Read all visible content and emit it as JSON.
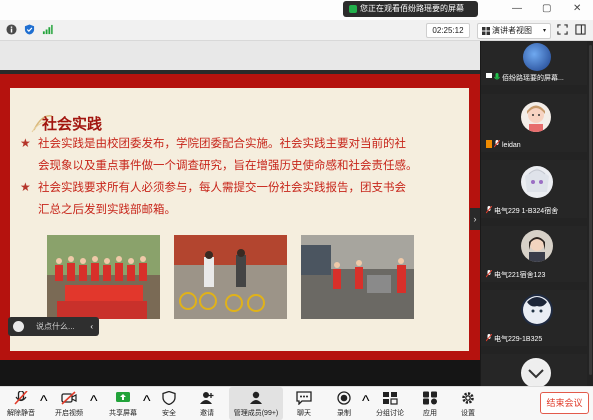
{
  "share_banner": {
    "text": "您正在观看佰纷路瑶要的屏幕"
  },
  "window_controls": {
    "minimize": "—",
    "maximize": "▢",
    "close": "✕"
  },
  "timer": "02:25:12",
  "view_button": {
    "label": "演讲者视图",
    "caret": "▾"
  },
  "slide": {
    "title": "社会实践",
    "bullets": [
      {
        "lines": [
          "社会实践是由校团委发布，学院团委配合实施。社会实践主要对当前的社",
          "会现象以及重点事件做一个调查研究，旨在增强历史使命感和社会责任感。"
        ]
      },
      {
        "lines": [
          "社会实践要求所有人必须参与，每人需提交一份社会实践报告，团支书会",
          "汇总之后发到实践部邮箱。"
        ]
      }
    ]
  },
  "chat": {
    "placeholder": "说点什么...",
    "collapse": "‹"
  },
  "side_toggle": "›",
  "participants": [
    {
      "name": "佰纷路瑶要的屏幕..."
    },
    {
      "name": "leidan"
    },
    {
      "name": "电气229   1-B324宿舍"
    },
    {
      "name": "电气221宿舍123"
    },
    {
      "name": "电气229-1B325"
    },
    {
      "name": ""
    }
  ],
  "toolbar": {
    "items": [
      {
        "label": "解除静音",
        "icon": "muted-mic-icon"
      },
      {
        "label": "开启视频",
        "icon": "video-off-icon"
      },
      {
        "label": "共享屏幕",
        "icon": "share-screen-icon"
      },
      {
        "label": "安全",
        "icon": "shield-icon"
      },
      {
        "label": "邀请",
        "icon": "invite-icon"
      },
      {
        "label": "管理成员(99+)",
        "icon": "members-icon"
      },
      {
        "label": "聊天",
        "icon": "chat-icon"
      },
      {
        "label": "录制",
        "icon": "record-icon"
      },
      {
        "label": "分组讨论",
        "icon": "breakout-icon"
      },
      {
        "label": "应用",
        "icon": "apps-icon"
      },
      {
        "label": "设置",
        "icon": "gear-icon"
      }
    ],
    "end_label": "结束会议"
  },
  "colors": {
    "slide_red": "#b5120e",
    "slide_bg": "#f5eede",
    "text_red": "#c7251a",
    "end_red": "#e03b2a"
  }
}
